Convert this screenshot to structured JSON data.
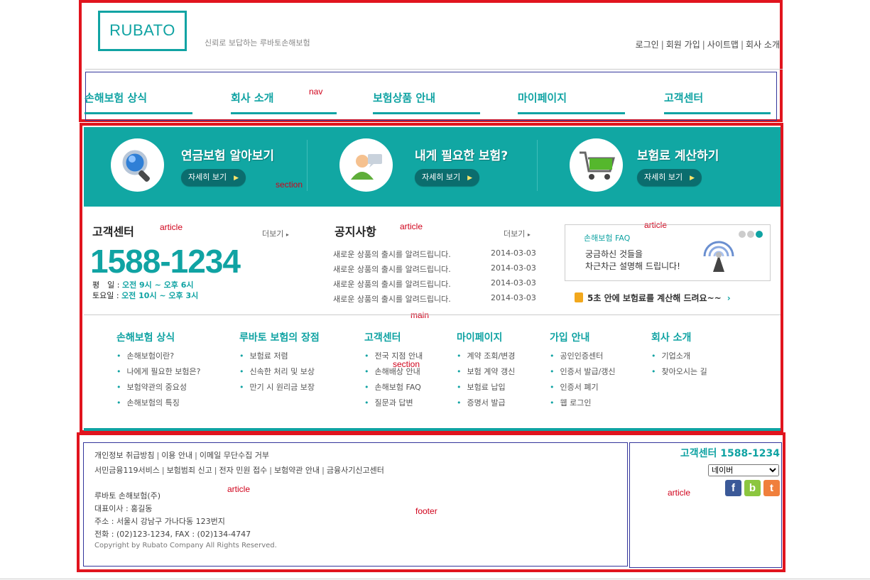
{
  "header": {
    "logo": "RUBATO",
    "slogan": "신뢰로 보답하는 루바토손해보험",
    "links": [
      "로그인",
      "회원 가입",
      "사이트맵",
      "회사 소개"
    ],
    "link_separator": "|"
  },
  "nav": {
    "label": "nav",
    "items": [
      "손해보험 상식",
      "회사 소개",
      "보험상품 안내",
      "마이페이지",
      "고객센터"
    ]
  },
  "section_label": "section",
  "article_label": "article",
  "main_label": "main",
  "footer_label": "footer",
  "banner": {
    "items": [
      {
        "title": "연금보험 알아보기",
        "button": "자세히 보기",
        "icon": "magnifier-icon"
      },
      {
        "title": "내게 필요한 보험?",
        "button": "자세히 보기",
        "icon": "person-chat-icon"
      },
      {
        "title": "보험료 계산하기",
        "button": "자세히 보기",
        "icon": "shopping-cart-icon"
      }
    ]
  },
  "customer_center": {
    "title": "고객센터",
    "more": "더보기",
    "phone": "1588-1234",
    "weekday_label": "평　일 :",
    "weekday_hours": "오전  9시 ~ 오후 6시",
    "saturday_label": "토요일 :",
    "saturday_hours": "오전 10시 ~ 오후 3시"
  },
  "notice": {
    "title": "공지사항",
    "more": "더보기",
    "rows": [
      {
        "text": "새로운 상품의 출시를 알려드립니다.",
        "date": "2014-03-03"
      },
      {
        "text": "새로운 상품의 출시를 알려드립니다.",
        "date": "2014-03-03"
      },
      {
        "text": "새로운 상품의 출시를 알려드립니다.",
        "date": "2014-03-03"
      },
      {
        "text": "새로운 상품의 출시를 알려드립니다.",
        "date": "2014-03-03"
      }
    ]
  },
  "faq": {
    "label": "손해보험 FAQ",
    "line1": "궁금하신 것들을",
    "line2": "차근차근 설명해 드립니다!",
    "calc_text": "5초 안에 보험료를 계산해 드려요~~"
  },
  "sitemap": [
    {
      "title": "손해보험 상식",
      "items": [
        "손해보험이란?",
        "나에게 필요한 보험은?",
        "보험약관의 중요성",
        "손해보험의 특징"
      ]
    },
    {
      "title": "루바토 보험의 장점",
      "items": [
        "보험료 저렴",
        "신속한 처리 및 보상",
        "만기 시 원리금 보장"
      ]
    },
    {
      "title": "고객센터",
      "items": [
        "전국 지점 안내",
        "손해배상 안내",
        "손해보험 FAQ",
        "질문과 답변"
      ]
    },
    {
      "title": "마이페이지",
      "items": [
        "계약 조회/변경",
        "보험 계약 갱신",
        "보험료 납입",
        "증명서 발급"
      ]
    },
    {
      "title": "가입 안내",
      "items": [
        "공인인증센터",
        "인증서 발급/갱신",
        "인증서 폐기",
        "웹 로그인"
      ]
    },
    {
      "title": "회사 소개",
      "items": [
        "기업소개",
        "찾아오시는 길"
      ]
    }
  ],
  "footer": {
    "links1": [
      "개인정보 취급방침",
      "이용 안내",
      "이메일 무단수집 거부"
    ],
    "links2": [
      "서민금융119서비스",
      "보험범죄 신고",
      "전자 민원 접수",
      "보험약관 안내",
      "금융사기신고센터"
    ],
    "company": "루바토 손해보험(주)",
    "ceo": "대표이사 : 홍길동",
    "address": "주소 : 서울시 강남구 가나다동 123번지",
    "tel": "전화 : (02)123-1234, FAX : (02)134-4747",
    "copyright": "Copyright by Rubato Company All Rights Reserved.",
    "cs_title": "고객센터 1588-1234",
    "select_value": "네이버",
    "sns": [
      {
        "letter": "f",
        "color": "#3b5998",
        "icon": "facebook-icon"
      },
      {
        "letter": "b",
        "color": "#8cc63f",
        "icon": "blog-icon"
      },
      {
        "letter": "t",
        "color": "#f07f3c",
        "icon": "twitter-icon"
      }
    ]
  },
  "colors": {
    "accent": "#10a3a3",
    "debug_border": "#e1141e",
    "nav_border": "#33359b"
  }
}
